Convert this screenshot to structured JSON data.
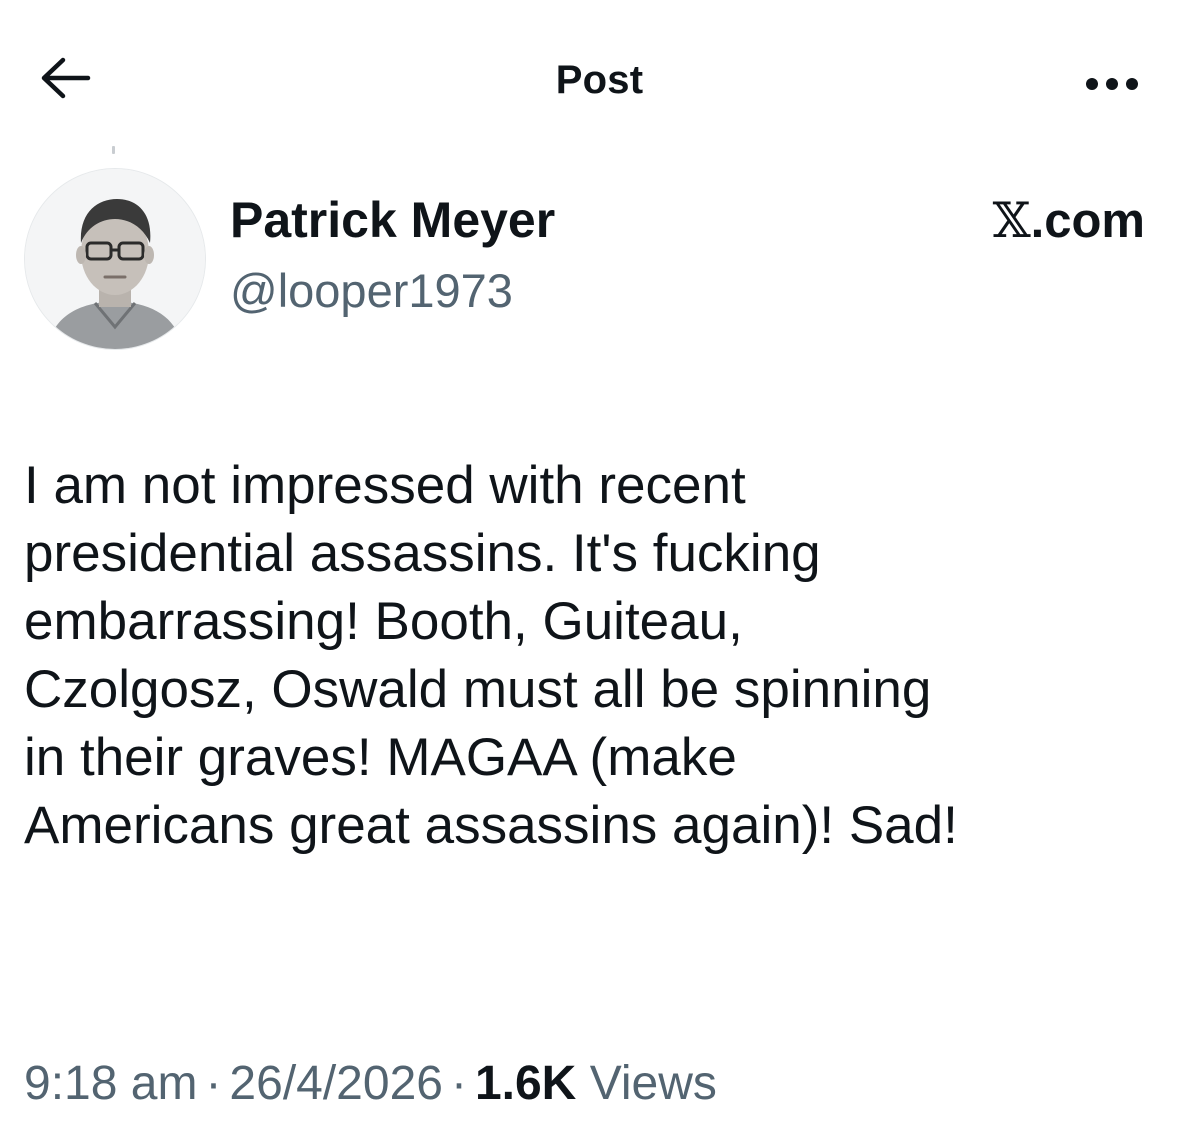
{
  "header": {
    "title": "Post",
    "back_icon": "arrow-left-icon",
    "more_icon": "more-horizontal-icon"
  },
  "author": {
    "display_name": "Patrick Meyer",
    "handle": "@looper1973",
    "avatar": "avatar-photo"
  },
  "source": {
    "mark": "𝕏",
    "text": ".com"
  },
  "post": {
    "lines": [
      "I am not impressed with recent",
      "presidential assassins.  It's fucking",
      "embarrassing!  Booth, Guiteau,",
      "Czolgosz, Oswald must all be spinning",
      "in their graves!  MAGAA (make",
      "Americans great assassins again)!  Sad!"
    ]
  },
  "meta": {
    "time": "9:18 am",
    "separator": "·",
    "date": "26/4/2026",
    "views_count": "1.6K",
    "views_label": "Views"
  },
  "colors": {
    "text_primary": "#0f1419",
    "text_secondary": "#536471",
    "background": "#ffffff"
  }
}
